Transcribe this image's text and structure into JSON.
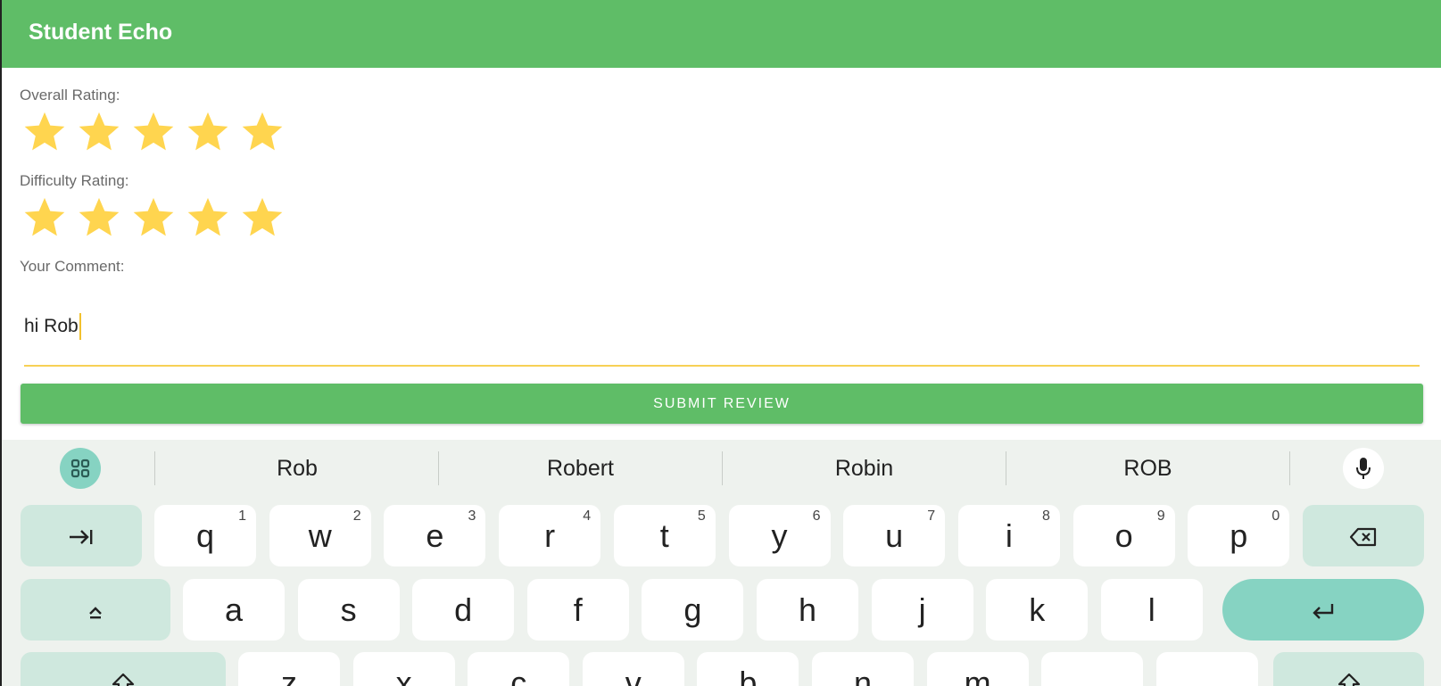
{
  "app": {
    "title": "Student Echo"
  },
  "form": {
    "overall_label": "Overall Rating:",
    "overall_rating": 5,
    "overall_max": 5,
    "difficulty_label": "Difficulty Rating:",
    "difficulty_rating": 5,
    "difficulty_max": 5,
    "comment_label": "Your Comment:",
    "comment_value": "hi Rob",
    "submit_label": "SUBMIT REVIEW"
  },
  "keyboard": {
    "suggestions": [
      "Rob",
      "Robert",
      "Robin",
      "ROB"
    ],
    "row1": [
      {
        "key": "q",
        "hint": "1"
      },
      {
        "key": "w",
        "hint": "2"
      },
      {
        "key": "e",
        "hint": "3"
      },
      {
        "key": "r",
        "hint": "4"
      },
      {
        "key": "t",
        "hint": "5"
      },
      {
        "key": "y",
        "hint": "6"
      },
      {
        "key": "u",
        "hint": "7"
      },
      {
        "key": "i",
        "hint": "8"
      },
      {
        "key": "o",
        "hint": "9"
      },
      {
        "key": "p",
        "hint": "0"
      }
    ],
    "row2": [
      "a",
      "s",
      "d",
      "f",
      "g",
      "h",
      "j",
      "k",
      "l"
    ],
    "row3": [
      "z",
      "x",
      "c",
      "v",
      "b",
      "n",
      "m",
      "",
      ""
    ]
  },
  "colors": {
    "accent": "#5fbd67",
    "star": "#ffd54f",
    "underline": "#f7d155",
    "keyboard_bg": "#eef2ee"
  },
  "icons": {
    "apps": "grid-icon",
    "mic": "mic-icon",
    "tab": "tab-icon",
    "backspace": "backspace-icon",
    "shift_lock": "caps-icon",
    "enter": "enter-icon",
    "shift": "shift-icon"
  }
}
